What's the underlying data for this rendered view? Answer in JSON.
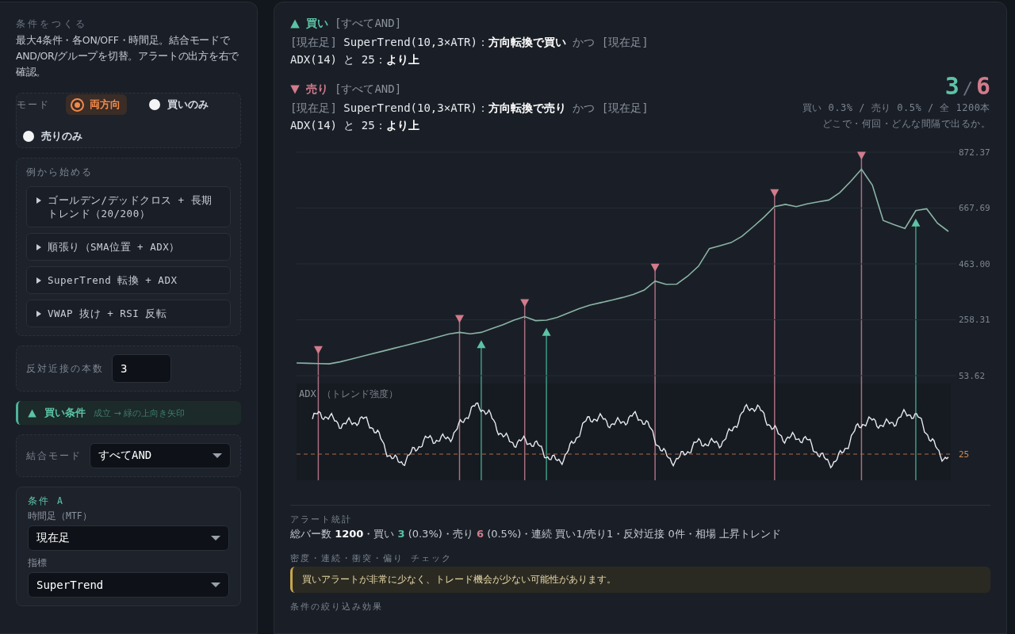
{
  "left": {
    "heading": "条件をつくる",
    "description": "最大4条件・各ON/OFF・時間足。結合モードでAND/OR/グループを切替。アラートの出方を右で確認。",
    "mode": {
      "label": "モード",
      "options": [
        {
          "label": "両方向",
          "selected": true
        },
        {
          "label": "買いのみ",
          "selected": false
        },
        {
          "label": "売りのみ",
          "selected": false
        }
      ]
    },
    "examples": {
      "label": "例から始める",
      "items": [
        "ゴールデン/デッドクロス + 長期トレンド（20/200）",
        "順張り（SMA位置 + ADX）",
        "SuperTrend 転換 + ADX",
        "VWAP 抜け + RSI 反転"
      ]
    },
    "opposite": {
      "label": "反対近接の本数",
      "value": "3"
    },
    "buy_header": {
      "title": "買い条件",
      "note": "成立 → 緑の上向き矢印"
    },
    "combine": {
      "label": "結合モード",
      "value": "すべてAND"
    },
    "condition": {
      "title": "条件 A",
      "timeframe_label": "時間足（MTF）",
      "timeframe": "現在足",
      "indicator_label": "指標",
      "indicator": "SuperTrend"
    }
  },
  "summary": [
    {
      "kind": "buy",
      "title": "買い",
      "mode": "[すべてAND]",
      "line": [
        {
          "kind": "tf",
          "text": "[現在足] "
        },
        {
          "kind": "text",
          "text": "SuperTrend(10,3×ATR)："
        },
        {
          "kind": "strong",
          "text": "方向転換で買い "
        },
        {
          "kind": "tf",
          "text": "かつ [現在足] "
        },
        {
          "kind": "text",
          "text": "ADX(14) と 25："
        },
        {
          "kind": "strong",
          "text": "より上"
        }
      ]
    },
    {
      "kind": "sell",
      "title": "売り",
      "mode": "[すべてAND]",
      "line": [
        {
          "kind": "tf",
          "text": "[現在足] "
        },
        {
          "kind": "text",
          "text": "SuperTrend(10,3×ATR)："
        },
        {
          "kind": "strong",
          "text": "方向転換で売り "
        },
        {
          "kind": "tf",
          "text": "かつ [現在足] "
        },
        {
          "kind": "text",
          "text": "ADX(14) と 25："
        },
        {
          "kind": "strong",
          "text": "より上"
        }
      ]
    }
  ],
  "counts": {
    "buy": "3",
    "separator": "/",
    "sell": "6",
    "detail": "買い 0.3% / 売り 0.5% / 全 1200本",
    "caption": "どこで・何回・どんな間隔で出るか。"
  },
  "price_chart": {
    "chart_data": {
      "type": "line",
      "ylim": [
        53.62,
        872.37
      ],
      "categories": [
        null,
        null,
        null,
        null,
        null,
        null,
        null,
        null,
        null,
        null,
        null,
        null,
        null,
        null,
        null,
        null,
        null,
        null,
        null,
        null,
        null,
        null,
        null,
        null,
        null,
        null,
        null,
        null,
        null,
        null,
        null,
        null,
        null,
        null,
        null,
        null,
        null,
        null,
        null,
        null,
        null,
        null,
        null,
        null,
        null,
        null,
        null,
        null,
        null,
        null,
        null,
        null,
        null,
        null,
        null,
        null,
        null,
        null,
        null,
        null,
        null
      ],
      "series": [
        {
          "color": "#8ab4a6",
          "values": [
            100,
            99,
            98,
            97,
            104,
            114,
            124,
            134,
            144,
            154,
            164,
            174,
            184,
            195,
            206,
            212,
            207,
            212,
            226,
            240,
            257,
            270,
            255,
            257,
            267,
            283,
            299,
            312,
            321,
            330,
            340,
            351,
            367,
            400,
            388,
            389,
            418,
            455,
            519,
            530,
            541,
            564,
            598,
            633,
            673,
            681,
            673,
            683,
            690,
            697,
            724,
            765,
            810,
            752,
            622,
            607,
            593,
            658,
            665,
            612,
            582
          ]
        },
        {
          "color": "#d27b8c",
          "type": "scatter",
          "marker": "triangle",
          "values": [
            null,
            null,
            147,
            null,
            null,
            null,
            null,
            null,
            null,
            null,
            null,
            null,
            null,
            null,
            null,
            261,
            null,
            null,
            null,
            null,
            null,
            319,
            null,
            null,
            null,
            null,
            null,
            null,
            null,
            null,
            null,
            null,
            null,
            449,
            null,
            null,
            null,
            null,
            null,
            null,
            null,
            null,
            null,
            null,
            722,
            null,
            null,
            null,
            null,
            null,
            null,
            null,
            859,
            null,
            null,
            null,
            null,
            null,
            null,
            null,
            null
          ]
        },
        {
          "color": "#5cc3a6",
          "type": "scatter",
          "marker": "triangle",
          "values": [
            null,
            null,
            null,
            null,
            null,
            null,
            null,
            null,
            null,
            null,
            null,
            null,
            null,
            null,
            null,
            null,
            null,
            169,
            null,
            null,
            null,
            null,
            null,
            214,
            null,
            null,
            null,
            null,
            null,
            null,
            null,
            null,
            null,
            null,
            null,
            null,
            null,
            null,
            null,
            null,
            null,
            null,
            null,
            null,
            null,
            null,
            null,
            null,
            null,
            null,
            null,
            null,
            null,
            null,
            null,
            null,
            null,
            615,
            null,
            null,
            null
          ]
        }
      ],
      "grid": true,
      "yticks": [
        {
          "value": 872.37,
          "label": "872.37"
        },
        {
          "value": 667.69,
          "label": "667.69"
        },
        {
          "value": 463.0,
          "label": "463.00"
        },
        {
          "value": 258.31,
          "label": "258.31"
        },
        {
          "value": 53.62,
          "label": "53.62"
        }
      ]
    }
  },
  "adx": {
    "label": "ADX",
    "sublabel": "（トレンド強度）",
    "threshold_label": "25"
  },
  "stats": {
    "title": "アラート統計",
    "line": [
      {
        "kind": "plain",
        "text": "総バー数 "
      },
      {
        "kind": "strong",
        "text": "1200"
      },
      {
        "kind": "plain",
        "text": "・買い "
      },
      {
        "kind": "buy",
        "text": "3"
      },
      {
        "kind": "plain",
        "text": " (0.3%)・売り "
      },
      {
        "kind": "sell",
        "text": "6"
      },
      {
        "kind": "plain",
        "text": " (0.5%)・連続 買い1/売り1・反対近接 0件・相場 上昇トレンド"
      }
    ]
  },
  "check": {
    "title": "密度・連続・衝突・偏り チェック",
    "warning": "買いアラートが非常に少なく、トレード機会が少ない可能性があります。"
  },
  "next_title": "条件の絞り込み効果"
}
